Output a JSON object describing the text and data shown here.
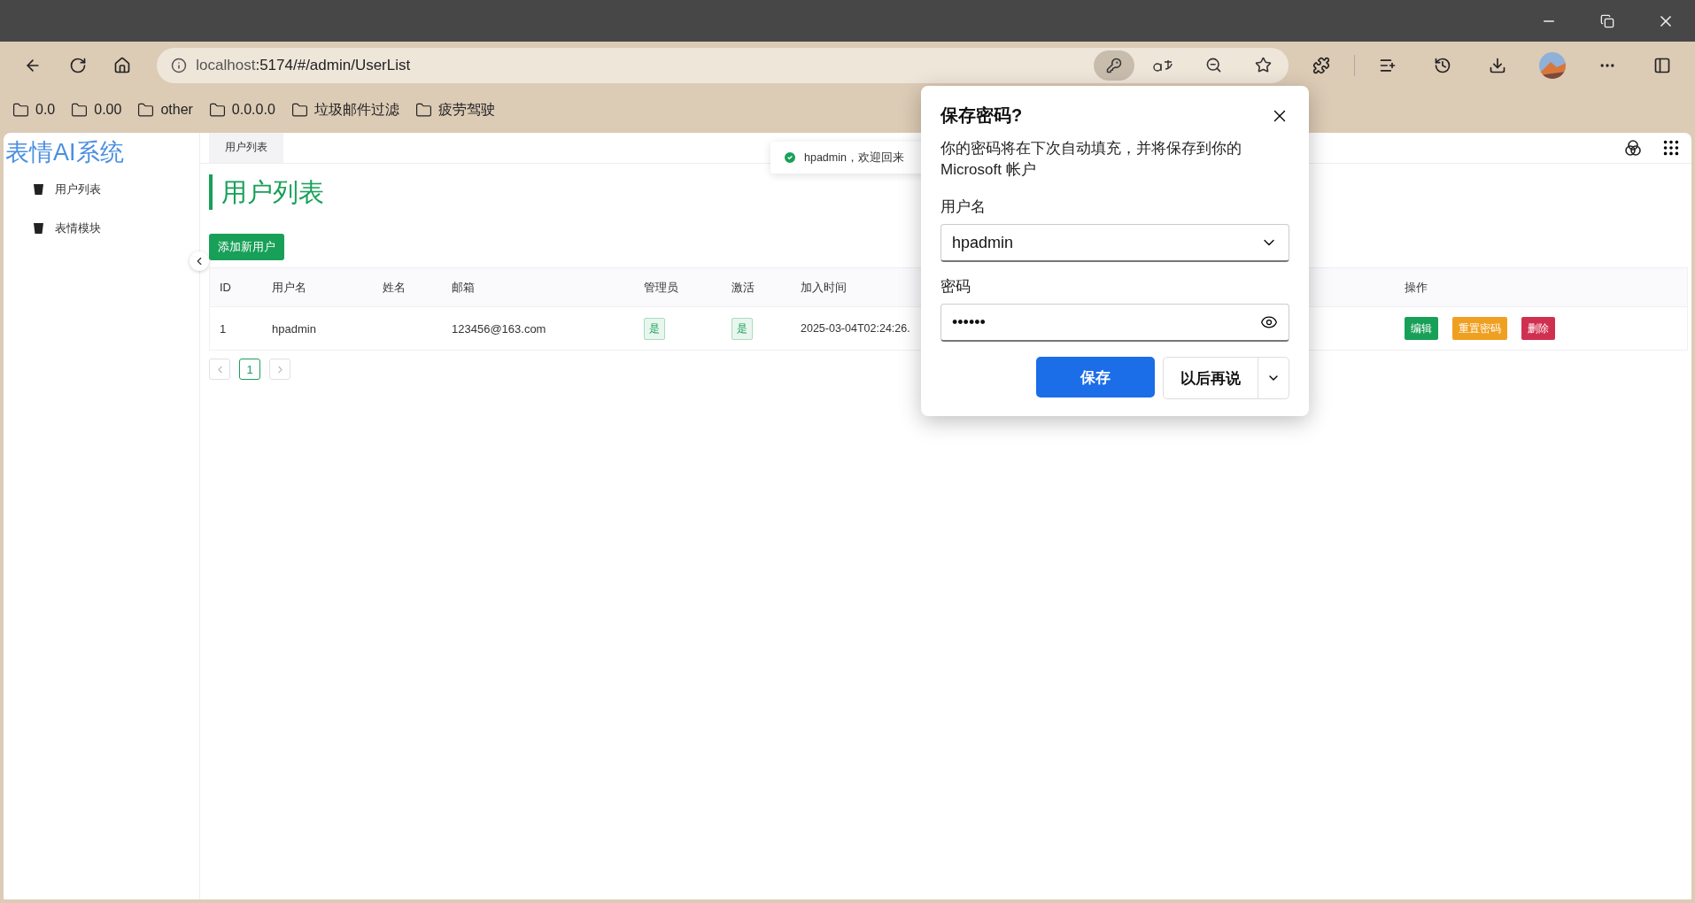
{
  "address_bar": {
    "host": "localhost",
    "path": ":5174/#/admin/UserList"
  },
  "bookmarks": [
    {
      "label": "0.0"
    },
    {
      "label": "0.00"
    },
    {
      "label": "other"
    },
    {
      "label": "0.0.0.0"
    },
    {
      "label": "垃圾邮件过滤"
    },
    {
      "label": "疲劳驾驶"
    }
  ],
  "app": {
    "brand": "表情AI系统",
    "menu": [
      {
        "label": "用户列表"
      },
      {
        "label": "表情模块"
      }
    ]
  },
  "tabs": [
    {
      "label": "用户列表",
      "selected": true
    }
  ],
  "page_title": "用户列表",
  "add_button": "添加新用户",
  "table": {
    "columns": [
      "ID",
      "用户名",
      "姓名",
      "邮箱",
      "管理员",
      "激活",
      "加入时间",
      "操作"
    ],
    "rows": [
      {
        "id": "1",
        "username": "hpadmin",
        "email": "123456@163.com",
        "admin": "是",
        "active": "是",
        "joined": "2025-03-04T02:24:26.",
        "actions": [
          {
            "label": "编辑",
            "kind": "edit"
          },
          {
            "label": "重置密码",
            "kind": "reset"
          },
          {
            "label": "删除",
            "kind": "delete"
          }
        ]
      }
    ]
  },
  "pagination": {
    "pages": [
      {
        "label": "1",
        "selected": true
      }
    ]
  },
  "toast": {
    "message": "hpadmin，欢迎回来"
  },
  "save_password_dialog": {
    "title": "保存密码?",
    "description": "你的密码将在下次自动填充，并将保存到你的 Microsoft 帐户",
    "username_label": "用户名",
    "username_value": "hpadmin",
    "password_label": "密码",
    "password_value": "••••••",
    "save_button": "保存",
    "later_button": "以后再说"
  }
}
